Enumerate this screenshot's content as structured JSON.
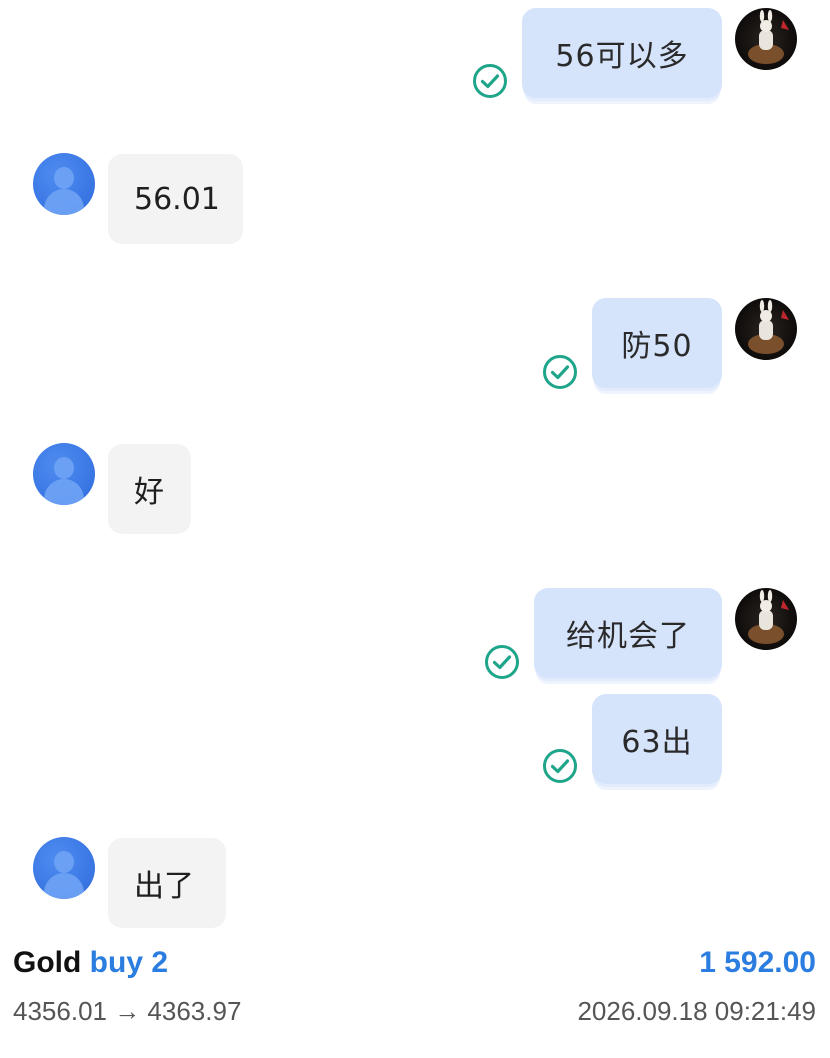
{
  "messages": [
    {
      "from": "self",
      "text": "56可以多",
      "status": "read-check-icon"
    },
    {
      "from": "other",
      "text": "56.01"
    },
    {
      "from": "self",
      "text": "防50",
      "status": "read-check-icon"
    },
    {
      "from": "other",
      "text": "好"
    },
    {
      "from": "self",
      "text": "给机会了",
      "status": "read-check-icon"
    },
    {
      "from": "self",
      "text": "63出",
      "status": "read-check-icon"
    },
    {
      "from": "other",
      "text": "出了"
    }
  ],
  "trade": {
    "symbol": "Gold",
    "direction": "buy 2",
    "profit": "1 592.00",
    "prices": "4356.01 → 4363.97",
    "time": "2026.09.18 09:21:49"
  },
  "colors": {
    "outgoing_bubble": "#d5e3fb",
    "incoming_bubble": "#f3f3f4",
    "check": "#1fa58a",
    "accent": "#2b7de0"
  }
}
